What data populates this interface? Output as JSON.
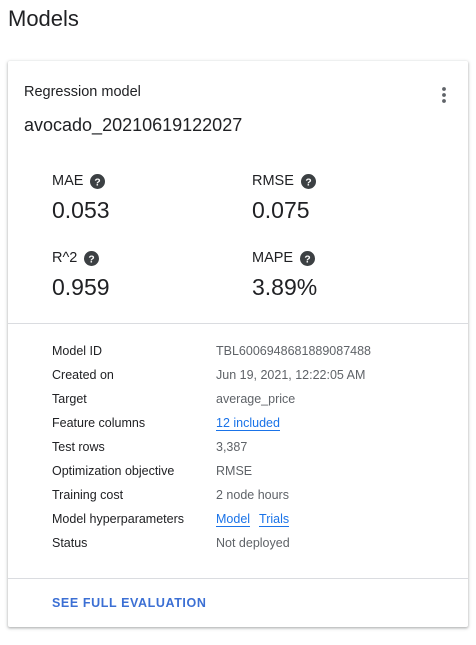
{
  "page": {
    "title": "Models"
  },
  "card": {
    "kicker": "Regression model",
    "name": "avocado_20210619122027",
    "more_icon": "more-vert-icon",
    "help_icon": "help-circle-icon"
  },
  "metrics": [
    {
      "label": "MAE",
      "value": "0.053"
    },
    {
      "label": "RMSE",
      "value": "0.075"
    },
    {
      "label": "R^2",
      "value": "0.959"
    },
    {
      "label": "MAPE",
      "value": "3.89%"
    }
  ],
  "details": {
    "model_id": {
      "label": "Model ID",
      "value": "TBL6006948681889087488"
    },
    "created_on": {
      "label": "Created on",
      "value": "Jun 19, 2021, 12:22:05 AM"
    },
    "target": {
      "label": "Target",
      "value": "average_price"
    },
    "feature_columns": {
      "label": "Feature columns",
      "value": "12 included"
    },
    "test_rows": {
      "label": "Test rows",
      "value": "3,387"
    },
    "optimization_objective": {
      "label": "Optimization objective",
      "value": "RMSE"
    },
    "training_cost": {
      "label": "Training cost",
      "value": "2 node hours"
    },
    "hyperparameters": {
      "label": "Model hyperparameters",
      "links": [
        "Model",
        "Trials"
      ]
    },
    "status": {
      "label": "Status",
      "value": "Not deployed"
    }
  },
  "actions": {
    "see_full_evaluation": "SEE FULL EVALUATION"
  },
  "colors": {
    "link": "#1a73e8",
    "cta": "#3b6fd4",
    "muted_text": "#5f6368",
    "divider": "#dadce0"
  }
}
